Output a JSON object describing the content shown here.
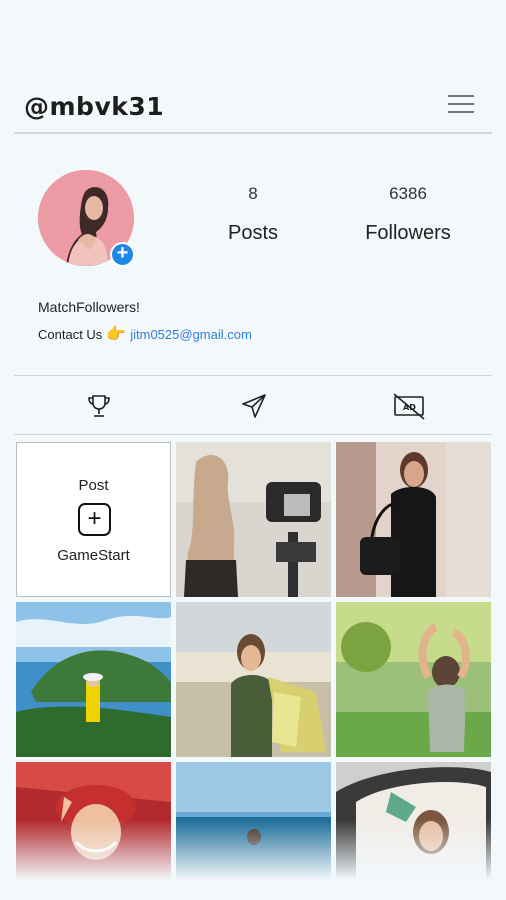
{
  "header": {
    "handle": "@mbvk31",
    "menu_icon": "hamburger-menu-icon"
  },
  "profile": {
    "avatar_icon": "profile-photo",
    "add_badge": "+",
    "stats": [
      {
        "value": "8",
        "label": "Posts"
      },
      {
        "value": "6386",
        "label": "Followers"
      }
    ],
    "bio_name": "MatchFollowers!",
    "contact_prefix": "Contact Us",
    "contact_emoji": "👉",
    "contact_email": "jitm0525@gmail.com"
  },
  "tabs": [
    {
      "icon": "trophy-icon"
    },
    {
      "icon": "send-icon"
    },
    {
      "icon": "no-ads-icon"
    }
  ],
  "grid": {
    "post_tile": {
      "top_label": "Post",
      "plus": "+",
      "bottom_label": "GameStart"
    },
    "photos": [
      "photo-camera-tripod",
      "photo-woman-black-outfit",
      "photo-island-view",
      "photo-woman-shopping-bags",
      "photo-woman-park",
      "photo-woman-red-hat",
      "photo-beach",
      "photo-woman-car"
    ]
  },
  "colors": {
    "background": "#f3f8fb",
    "accent": "#1d86e6",
    "link": "#2f7fe0"
  }
}
